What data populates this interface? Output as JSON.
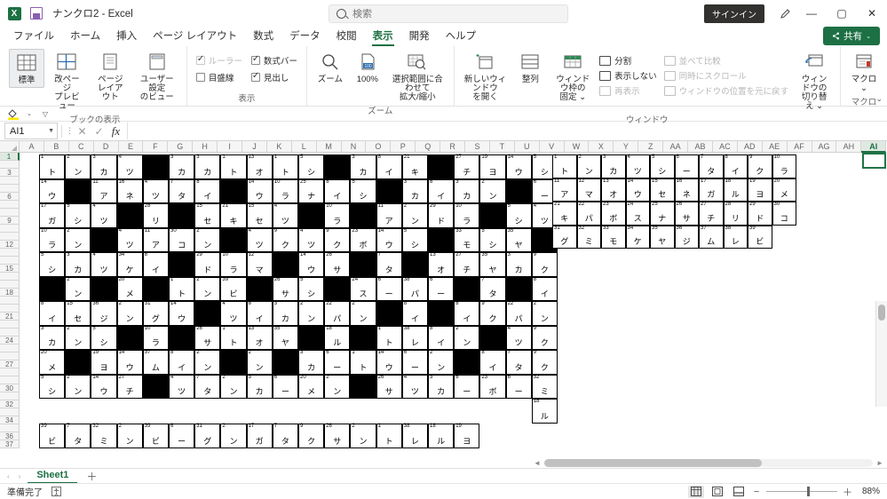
{
  "titlebar": {
    "doc_title": "ナンクロ2  -  Excel",
    "signin_label": "サインイン",
    "minimize": "—",
    "restore": "▢",
    "close": "✕"
  },
  "search": {
    "placeholder": "検索",
    "value": ""
  },
  "tabs": [
    {
      "label": "ファイル",
      "active": false
    },
    {
      "label": "ホーム",
      "active": false
    },
    {
      "label": "挿入",
      "active": false
    },
    {
      "label": "ページ レイアウト",
      "active": false
    },
    {
      "label": "数式",
      "active": false
    },
    {
      "label": "データ",
      "active": false
    },
    {
      "label": "校閲",
      "active": false
    },
    {
      "label": "表示",
      "active": true
    },
    {
      "label": "開発",
      "active": false
    },
    {
      "label": "ヘルプ",
      "active": false
    }
  ],
  "share_label": "共有",
  "ribbon": {
    "groups": [
      {
        "name": "ブックの表示",
        "buttons": [
          {
            "label": "標準",
            "selected": true
          },
          {
            "label": "改ページ\nプレビュー",
            "selected": false
          },
          {
            "label": "ページ\nレイアウト",
            "selected": false
          },
          {
            "label": "ユーザー設定\nのビュー",
            "selected": false
          }
        ]
      },
      {
        "name": "表示",
        "checks": [
          {
            "label": "ルーラー",
            "checked": true,
            "disabled": true
          },
          {
            "label": "数式バー",
            "checked": true,
            "disabled": false
          },
          {
            "label": "目盛線",
            "checked": false,
            "disabled": false
          },
          {
            "label": "見出し",
            "checked": true,
            "disabled": false
          }
        ]
      },
      {
        "name": "ズーム",
        "buttons": [
          {
            "label": "ズーム",
            "selected": false
          },
          {
            "label": "100%",
            "selected": false
          },
          {
            "label": "選択範囲に合わせて\n拡大/縮小",
            "selected": false
          }
        ]
      },
      {
        "name": "ウィンドウ",
        "buttons": [
          {
            "label": "新しいウィンドウ\nを開く",
            "selected": false
          },
          {
            "label": "整列",
            "selected": false
          },
          {
            "label": "ウィンドウ枠の\n固定 ⌄",
            "selected": false
          }
        ],
        "small_left": [
          {
            "label": "分割",
            "disabled": false
          },
          {
            "label": "表示しない",
            "disabled": false
          },
          {
            "label": "再表示",
            "disabled": true
          }
        ],
        "small_right": [
          {
            "label": "並べて比較",
            "disabled": true
          },
          {
            "label": "同時にスクロール",
            "disabled": true
          },
          {
            "label": "ウィンドウの位置を元に戻す",
            "disabled": true
          }
        ],
        "switch_label": "ウィンドウの\n切り替え ⌄"
      },
      {
        "name": "マクロ",
        "buttons": [
          {
            "label": "マクロ\n⌄",
            "selected": false
          }
        ]
      }
    ],
    "collapse_caret": "⌄"
  },
  "formula_bar": {
    "name_box": "AI1",
    "cancel_icon": "✕",
    "enter_icon": "✓",
    "function_icon": "fx",
    "value": ""
  },
  "sheet": {
    "column_headers": [
      "A",
      "B",
      "C",
      "D",
      "E",
      "F",
      "G",
      "H",
      "I",
      "J",
      "K",
      "L",
      "M",
      "N",
      "O",
      "P",
      "Q",
      "R",
      "S",
      "T",
      "U",
      "V",
      "W",
      "X",
      "Y",
      "Z",
      "AA",
      "AB",
      "AC",
      "AD",
      "AE",
      "AF",
      "AG",
      "AH",
      "AI"
    ],
    "selected_column": "AI",
    "selected_row": 1,
    "row_headers": [
      1,
      2,
      3,
      4,
      5,
      6,
      7,
      8,
      9,
      10,
      11,
      12,
      13,
      14,
      15,
      16,
      17,
      18,
      19,
      20,
      21,
      22,
      23,
      24,
      25,
      26,
      27,
      28,
      29,
      30,
      31,
      32,
      33,
      34,
      35,
      36,
      37
    ],
    "row_labels_shown": [
      1,
      3,
      6,
      9,
      12,
      15,
      18,
      21,
      24,
      27,
      30,
      32,
      34,
      36,
      37
    ]
  },
  "puzzle": {
    "title": "ナンクロ (Number Crossword)",
    "main_grid": {
      "cols": 19,
      "rows": 10,
      "rows_data": [
        [
          {
            "n": 1,
            "c": "ト"
          },
          {
            "n": 2,
            "c": "ン"
          },
          {
            "n": 3,
            "c": "カ"
          },
          {
            "n": 4,
            "c": "ツ"
          },
          null,
          {
            "n": 3,
            "c": "カ"
          },
          {
            "n": 3,
            "c": "カ"
          },
          {
            "n": 1,
            "c": "ト"
          },
          {
            "n": 13,
            "c": "オ"
          },
          {
            "n": 1,
            "c": "ト"
          },
          {
            "n": 5,
            "c": "シ"
          },
          null,
          {
            "n": 3,
            "c": "カ"
          },
          {
            "n": 8,
            "c": "イ"
          },
          {
            "n": 21,
            "c": "キ"
          },
          null,
          {
            "n": 27,
            "c": "チ"
          },
          {
            "n": 19,
            "c": "ヨ"
          },
          {
            "n": 14,
            "c": "ウ"
          }
        ],
        [
          {
            "n": 14,
            "c": "ウ"
          },
          null,
          {
            "n": 11,
            "c": "ア"
          },
          {
            "n": 16,
            "c": "ネ"
          },
          {
            "n": 4,
            "c": "ツ"
          },
          {
            "n": 7,
            "c": "タ"
          },
          {
            "n": 8,
            "c": "イ"
          },
          null,
          {
            "n": 14,
            "c": "ウ"
          },
          {
            "n": 10,
            "c": "ラ"
          },
          {
            "n": 25,
            "c": "ナ"
          },
          {
            "n": 8,
            "c": "イ"
          },
          {
            "n": 5,
            "c": "シ"
          },
          null,
          {
            "n": 3,
            "c": "カ"
          },
          {
            "n": 8,
            "c": "イ"
          },
          {
            "n": 3,
            "c": "カ"
          },
          {
            "n": 2,
            "c": "ン"
          },
          null
        ],
        [
          {
            "n": 17,
            "c": "ガ"
          },
          {
            "n": 5,
            "c": "シ"
          },
          {
            "n": 4,
            "c": "ツ"
          },
          null,
          {
            "n": 28,
            "c": "リ"
          },
          null,
          {
            "n": 15,
            "c": "セ"
          },
          {
            "n": 21,
            "c": "キ"
          },
          {
            "n": 15,
            "c": "セ"
          },
          {
            "n": 4,
            "c": "ツ"
          },
          null,
          {
            "n": 10,
            "c": "ラ"
          },
          null,
          {
            "n": 11,
            "c": "ア"
          },
          {
            "n": 2,
            "c": "ン"
          },
          {
            "n": 29,
            "c": "ド"
          },
          {
            "n": 10,
            "c": "ラ"
          },
          null,
          {
            "n": 5,
            "c": "シ"
          }
        ],
        [
          {
            "n": 10,
            "c": "ラ"
          },
          {
            "n": 2,
            "c": "ン"
          },
          null,
          {
            "n": 4,
            "c": "ツ"
          },
          {
            "n": 11,
            "c": "ア"
          },
          {
            "n": 30,
            "c": "コ"
          },
          {
            "n": 2,
            "c": "ン"
          },
          null,
          {
            "n": 4,
            "c": "ツ"
          },
          {
            "n": 9,
            "c": "ク"
          },
          {
            "n": 4,
            "c": "ツ"
          },
          {
            "n": 9,
            "c": "ク"
          },
          {
            "n": 23,
            "c": "ボ"
          },
          {
            "n": 14,
            "c": "ウ"
          },
          {
            "n": 5,
            "c": "シ"
          },
          null,
          {
            "n": 33,
            "c": "モ"
          },
          {
            "n": 5,
            "c": "シ"
          },
          {
            "n": 35,
            "c": "ヤ"
          }
        ],
        [
          {
            "n": 5,
            "c": "シ"
          },
          {
            "n": 3,
            "c": "カ"
          },
          {
            "n": 4,
            "c": "ツ"
          },
          {
            "n": 34,
            "c": "ケ"
          },
          {
            "n": 8,
            "c": "イ"
          },
          null,
          {
            "n": 29,
            "c": "ド"
          },
          {
            "n": 10,
            "c": "ラ"
          },
          {
            "n": 12,
            "c": "マ"
          },
          null,
          {
            "n": 14,
            "c": "ウ"
          },
          {
            "n": 26,
            "c": "サ"
          },
          null,
          {
            "n": 7,
            "c": "タ"
          },
          null,
          {
            "n": 13,
            "c": "オ"
          },
          {
            "n": 27,
            "c": "チ"
          },
          {
            "n": 35,
            "c": "ヤ"
          },
          {
            "n": 3,
            "c": "カ"
          }
        ],
        [
          null,
          {
            "n": 2,
            "c": "ン"
          },
          null,
          {
            "n": 20,
            "c": "メ"
          },
          null,
          {
            "n": 1,
            "c": "ト"
          },
          {
            "n": 2,
            "c": "ン"
          },
          {
            "n": 39,
            "c": "ビ"
          },
          null,
          {
            "n": 26,
            "c": "サ"
          },
          {
            "n": 5,
            "c": "シ"
          },
          null,
          {
            "n": 24,
            "c": "ス"
          },
          {
            "n": 6,
            "c": "ー"
          },
          {
            "n": 38,
            "c": "パ"
          },
          {
            "n": 6,
            "c": "ー"
          },
          null,
          {
            "n": 7,
            "c": "タ"
          },
          null
        ],
        [
          {
            "n": 8,
            "c": "イ"
          },
          {
            "n": 15,
            "c": "セ"
          },
          {
            "n": 36,
            "c": "ジ"
          },
          {
            "n": 2,
            "c": "ン"
          },
          {
            "n": 31,
            "c": "グ"
          },
          {
            "n": 14,
            "c": "ウ"
          },
          null,
          {
            "n": 4,
            "c": "ツ"
          },
          {
            "n": 8,
            "c": "イ"
          },
          {
            "n": 3,
            "c": "カ"
          },
          {
            "n": 2,
            "c": "ン"
          },
          {
            "n": 22,
            "c": "パ"
          },
          {
            "n": 2,
            "c": "ン"
          },
          null,
          {
            "n": 8,
            "c": "イ"
          },
          null,
          {
            "n": 8,
            "c": "イ"
          },
          {
            "n": 9,
            "c": "ク"
          },
          {
            "n": 22,
            "c": "パ"
          }
        ],
        [
          {
            "n": 3,
            "c": "カ"
          },
          {
            "n": 2,
            "c": "ン"
          },
          {
            "n": 5,
            "c": "シ"
          },
          null,
          {
            "n": 10,
            "c": "ラ"
          },
          null,
          {
            "n": 26,
            "c": "サ"
          },
          {
            "n": 1,
            "c": "ト"
          },
          {
            "n": 13,
            "c": "オ"
          },
          {
            "n": 35,
            "c": "ヤ"
          },
          null,
          {
            "n": 18,
            "c": "ル"
          },
          null,
          {
            "n": 1,
            "c": "ト"
          },
          {
            "n": 38,
            "c": "レ"
          },
          {
            "n": 8,
            "c": "イ"
          },
          {
            "n": 2,
            "c": "ン"
          },
          null,
          {
            "n": 4,
            "c": "ツ"
          }
        ],
        [
          {
            "n": 20,
            "c": "メ"
          },
          null,
          {
            "n": 19,
            "c": "ヨ"
          },
          {
            "n": 14,
            "c": "ウ"
          },
          {
            "n": 37,
            "c": "ム"
          },
          {
            "n": 8,
            "c": "イ"
          },
          {
            "n": 2,
            "c": "ン"
          },
          null,
          {
            "n": 2,
            "c": "ン"
          },
          null,
          {
            "n": 3,
            "c": "カ"
          },
          {
            "n": 6,
            "c": "ー"
          },
          {
            "n": 1,
            "c": "ト"
          },
          {
            "n": 14,
            "c": "ウ"
          },
          {
            "n": 6,
            "c": "ー"
          },
          {
            "n": 2,
            "c": "ン"
          },
          null,
          {
            "n": 8,
            "c": "イ"
          },
          {
            "n": 7,
            "c": "タ"
          }
        ],
        [
          {
            "n": 5,
            "c": "シ"
          },
          {
            "n": 2,
            "c": "ン"
          },
          {
            "n": 14,
            "c": "ウ"
          },
          {
            "n": 27,
            "c": "チ"
          },
          null,
          {
            "n": 4,
            "c": "ツ"
          },
          {
            "n": 7,
            "c": "タ"
          },
          {
            "n": 2,
            "c": "ン"
          },
          {
            "n": 3,
            "c": "カ"
          },
          {
            "n": 6,
            "c": "ー"
          },
          {
            "n": 20,
            "c": "メ"
          },
          {
            "n": 2,
            "c": "ン"
          },
          null,
          {
            "n": 26,
            "c": "サ"
          },
          {
            "n": 4,
            "c": "ツ"
          },
          {
            "n": 3,
            "c": "カ"
          },
          {
            "n": 6,
            "c": "ー"
          },
          {
            "n": 23,
            "c": "ボ"
          },
          {
            "n": 6,
            "c": "ー"
          }
        ]
      ],
      "extra_col": [
        {
          "n": 5,
          "c": "シ"
        },
        {
          "n": 6,
          "c": "ー"
        },
        {
          "n": 4,
          "c": "ツ"
        },
        null,
        {
          "n": 9,
          "c": "ク"
        },
        {
          "n": 8,
          "c": "イ"
        },
        {
          "n": 2,
          "c": "ン"
        },
        {
          "n": 9,
          "c": "ク"
        },
        {
          "n": 9,
          "c": "ク"
        },
        {
          "n": 32,
          "c": "ミ"
        },
        {
          "n": 18,
          "c": "ル"
        }
      ]
    },
    "answer_strip": [
      {
        "n": 39,
        "c": "ビ"
      },
      {
        "n": 7,
        "c": "タ"
      },
      {
        "n": 32,
        "c": "ミ"
      },
      {
        "n": 2,
        "c": "ン"
      },
      {
        "n": 39,
        "c": "ビ"
      },
      {
        "n": 6,
        "c": "ー"
      },
      {
        "n": 31,
        "c": "グ"
      },
      {
        "n": 2,
        "c": "ン"
      },
      {
        "n": 17,
        "c": "ガ"
      },
      {
        "n": 7,
        "c": "タ"
      },
      {
        "n": 9,
        "c": "ク"
      },
      {
        "n": 26,
        "c": "サ"
      },
      {
        "n": 2,
        "c": "ン"
      },
      {
        "n": 1,
        "c": "ト"
      },
      {
        "n": 38,
        "c": "レ"
      },
      {
        "n": 18,
        "c": "ル"
      },
      {
        "n": 19,
        "c": "ヨ"
      }
    ],
    "legend": {
      "cols": 10,
      "entries": [
        {
          "n": 1,
          "c": "ト"
        },
        {
          "n": 2,
          "c": "ン"
        },
        {
          "n": 3,
          "c": "カ"
        },
        {
          "n": 4,
          "c": "ツ"
        },
        {
          "n": 5,
          "c": "シ"
        },
        {
          "n": 6,
          "c": "ー"
        },
        {
          "n": 7,
          "c": "タ"
        },
        {
          "n": 8,
          "c": "イ"
        },
        {
          "n": 9,
          "c": "ク"
        },
        {
          "n": 10,
          "c": "ラ"
        },
        {
          "n": 11,
          "c": "ア"
        },
        {
          "n": 12,
          "c": "マ"
        },
        {
          "n": 13,
          "c": "オ"
        },
        {
          "n": 14,
          "c": "ウ"
        },
        {
          "n": 15,
          "c": "セ"
        },
        {
          "n": 16,
          "c": "ネ"
        },
        {
          "n": 17,
          "c": "ガ"
        },
        {
          "n": 18,
          "c": "ル"
        },
        {
          "n": 19,
          "c": "ヨ"
        },
        {
          "n": 20,
          "c": "メ"
        },
        {
          "n": 21,
          "c": "キ"
        },
        {
          "n": 22,
          "c": "パ"
        },
        {
          "n": 23,
          "c": "ボ"
        },
        {
          "n": 24,
          "c": "ス"
        },
        {
          "n": 25,
          "c": "ナ"
        },
        {
          "n": 26,
          "c": "サ"
        },
        {
          "n": 27,
          "c": "チ"
        },
        {
          "n": 28,
          "c": "リ"
        },
        {
          "n": 29,
          "c": "ド"
        },
        {
          "n": 30,
          "c": "コ"
        },
        {
          "n": 31,
          "c": "グ"
        },
        {
          "n": 32,
          "c": "ミ"
        },
        {
          "n": 33,
          "c": "モ"
        },
        {
          "n": 34,
          "c": "ケ"
        },
        {
          "n": 35,
          "c": "ヤ"
        },
        {
          "n": 36,
          "c": "ジ"
        },
        {
          "n": 37,
          "c": "ム"
        },
        {
          "n": 38,
          "c": "レ"
        },
        {
          "n": 39,
          "c": "ビ"
        }
      ]
    }
  },
  "sheet_tabs": {
    "prev": "‹",
    "next": "›",
    "tabs": [
      {
        "label": "Sheet1",
        "active": true
      }
    ],
    "add": "＋"
  },
  "status": {
    "mode": "準備完了",
    "accessibility_icon": "accessibility-icon",
    "view_normal": "normal-view",
    "view_layout": "page-layout-view",
    "view_break": "page-break-view",
    "zoom_out": "−",
    "zoom_in": "＋",
    "zoom_value": "88%"
  },
  "colors": {
    "excel_green": "#217346",
    "accent_dark": "#1d7044",
    "black_cell": "#000000",
    "grid_line": "#d4d4d4"
  }
}
